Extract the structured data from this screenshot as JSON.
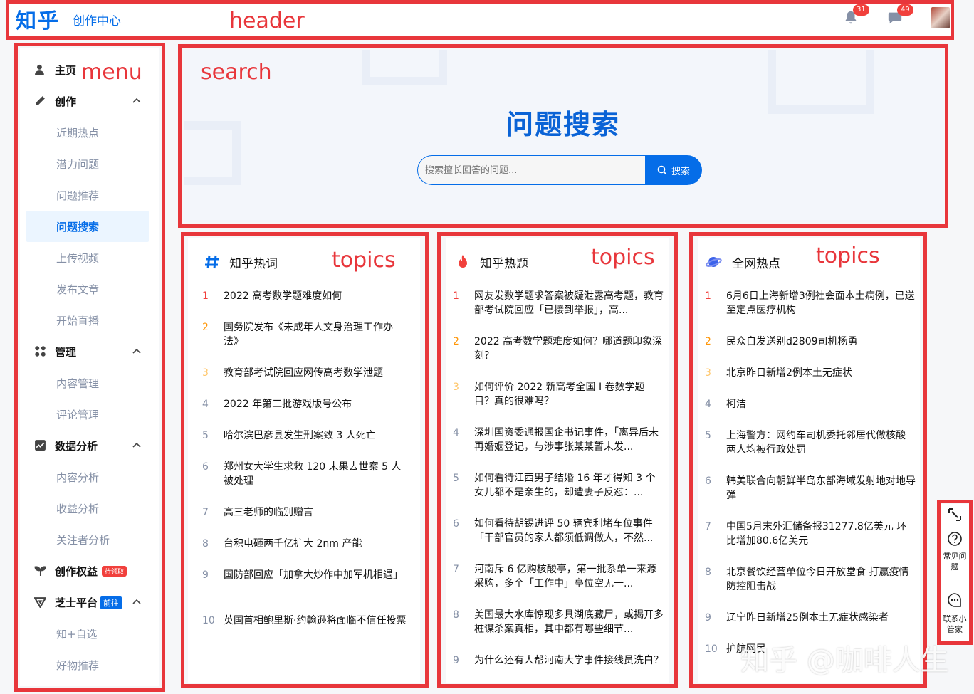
{
  "header": {
    "logo": "知乎",
    "subtitle": "创作中心",
    "notification_count": "31",
    "message_count": "49"
  },
  "sidebar": {
    "home": "主页",
    "create": "创作",
    "create_items": [
      "近期热点",
      "潜力问题",
      "问题推荐",
      "问题搜索",
      "上传视频",
      "发布文章",
      "开始直播"
    ],
    "manage": "管理",
    "manage_items": [
      "内容管理",
      "评论管理"
    ],
    "analytics": "数据分析",
    "analytics_items": [
      "内容分析",
      "收益分析",
      "关注者分析"
    ],
    "rights": "创作权益",
    "rights_tag": "待领取",
    "zhishi": "芝士平台",
    "zhishi_tag": "前往",
    "zhishi_items": [
      "知+自选",
      "好物推荐"
    ]
  },
  "search": {
    "title": "问题搜索",
    "placeholder": "搜索擅长回答的问题...",
    "button": "搜索"
  },
  "cards": [
    {
      "title": "知乎热词",
      "icon": "hashtag-icon",
      "items": [
        "2022 高考数学题难度如何",
        "国务院发布《未成年人文身治理工作办法》",
        "教育部考试院回应网传高考数学泄题",
        "2022 年第二批游戏版号公布",
        "哈尔滨巴彦县发生刑案致 3 人死亡",
        "郑州女大学生求救 120 未果去世案 5 人被处理",
        "高三老师的临别赠言",
        "台积电砸两千亿扩大 2nm 产能",
        "国防部回应「加拿大炒作中加军机相遇」",
        "英国首相鲍里斯·约翰逊将面临不信任投票"
      ]
    },
    {
      "title": "知乎热题",
      "icon": "flame-icon",
      "items": [
        "网友发数学题求答案被疑泄露高考题，教育部考试院回应「已接到举报」，高...",
        "2022 高考数学题难度如何？哪道题印象深刻？",
        "如何评价 2022 新高考全国 Ⅰ 卷数学题目？真的很难吗？",
        "深圳国资委通报国企书记事件，「离异后未再婚姻登记，与涉事张某某暂未发...",
        "如何看待江西男子结婚 16 年才得知 3 个女儿都不是亲生的，却遭妻子反怼：...",
        "如何看待胡锡进评 50 辆宾利堵车位事件「干部官员的家人都须低调做人，不然...",
        "河南斥 6 亿购核酸亭，第一批系单一来源采购，多个「工作中」亭位空无一...",
        "美国最大水库惊现多具湖底藏尸，或揭开多桩谋杀案真相，其中都有哪些细节...",
        "为什么还有人帮河南大学事件接线员洗白？"
      ]
    },
    {
      "title": "全网热点",
      "icon": "planet-icon",
      "items": [
        "6月6日上海新增3例社会面本土病例，已送至定点医疗机构",
        "民众自发送别d2809司机杨勇",
        "北京昨日新增2例本土无症状",
        "柯洁",
        "上海警方：网约车司机委托邻居代做核酸 两人均被行政处罚",
        "韩美联合向朝鲜半岛东部海域发射地对地导弹",
        "中国5月末外汇储备报31277.8亿美元 环比增加80.6亿美元",
        "北京餐饮经营单位今日开放堂食 打赢疫情防控阻击战",
        "辽宁昨日新增25例本土无症状感染者",
        "护航网民"
      ]
    }
  ],
  "float": {
    "faq": "常见问题",
    "contact": "联系小管家"
  },
  "annotations": {
    "header": "header",
    "menu": "menu",
    "search": "search",
    "topics": "topics"
  },
  "watermark": "知乎 @咖啡人生"
}
